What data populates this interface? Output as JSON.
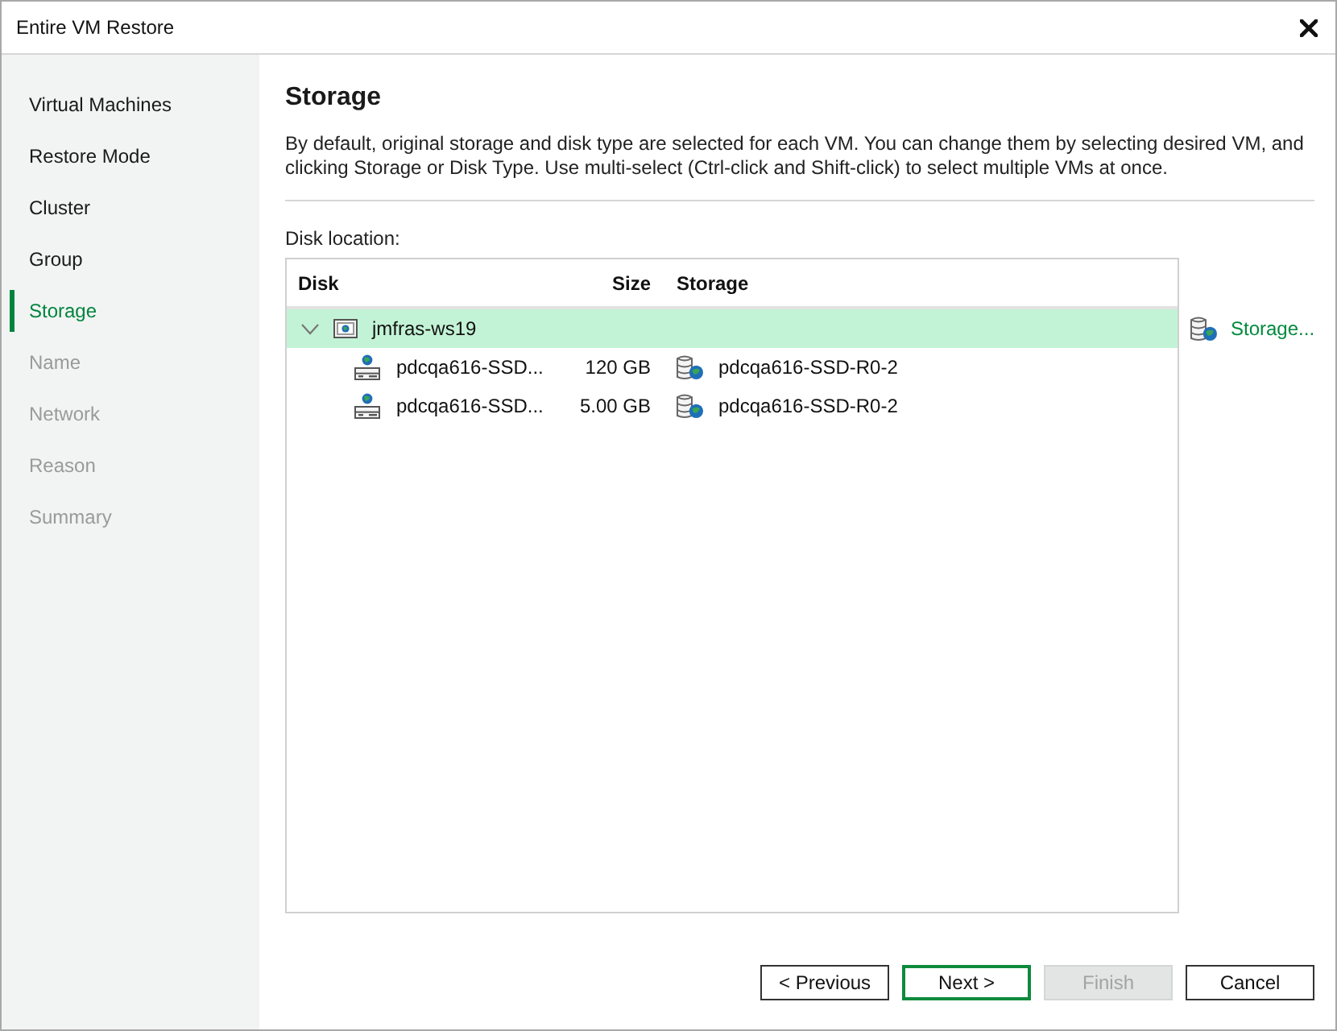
{
  "window": {
    "title": "Entire VM Restore"
  },
  "sidebar": {
    "items": [
      {
        "label": "Virtual Machines",
        "selected": false,
        "disabled": false
      },
      {
        "label": "Restore Mode",
        "selected": false,
        "disabled": false
      },
      {
        "label": "Cluster",
        "selected": false,
        "disabled": false
      },
      {
        "label": "Group",
        "selected": false,
        "disabled": false
      },
      {
        "label": "Storage",
        "selected": true,
        "disabled": false
      },
      {
        "label": "Name",
        "selected": false,
        "disabled": true
      },
      {
        "label": "Network",
        "selected": false,
        "disabled": true
      },
      {
        "label": "Reason",
        "selected": false,
        "disabled": true
      },
      {
        "label": "Summary",
        "selected": false,
        "disabled": true
      }
    ]
  },
  "page": {
    "title": "Storage",
    "description": "By default, original storage and disk type are selected for each VM. You can change them by selecting desired VM, and clicking Storage or Disk Type. Use multi-select (Ctrl-click and Shift-click) to select multiple VMs at once."
  },
  "disk_location": {
    "label": "Disk location:",
    "columns": [
      "Disk",
      "Size",
      "Storage"
    ],
    "rows": [
      {
        "name": "jmfras-ws19",
        "expanded": true,
        "selected": true,
        "children": [
          {
            "name": "pdcqa616-SSD...",
            "size": "120 GB",
            "storage": "pdcqa616-SSD-R0-2"
          },
          {
            "name": "pdcqa616-SSD...",
            "size": "5.00 GB",
            "storage": "pdcqa616-SSD-R0-2"
          }
        ]
      }
    ]
  },
  "side_actions": [
    {
      "label": "Storage..."
    }
  ],
  "buttons": [
    {
      "label": "< Previous",
      "kind": "default",
      "disabled": false
    },
    {
      "label": "Next >",
      "kind": "primary",
      "disabled": false
    },
    {
      "label": "Finish",
      "kind": "default",
      "disabled": true
    },
    {
      "label": "Cancel",
      "kind": "default",
      "disabled": false
    }
  ]
}
